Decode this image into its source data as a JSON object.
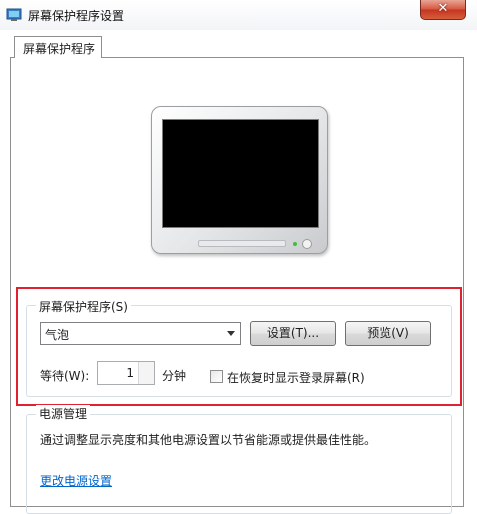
{
  "window": {
    "title": "屏幕保护程序设置",
    "close_glyph": "✕"
  },
  "tab": {
    "label": "屏幕保护程序"
  },
  "screensaver": {
    "group_label": "屏幕保护程序(S)",
    "selected": "气泡",
    "settings_button": "设置(T)...",
    "preview_button": "预览(V)",
    "wait_label": "等待(W):",
    "wait_value": "1",
    "wait_unit": "分钟",
    "resume_checkbox_label": "在恢复时显示登录屏幕(R)",
    "resume_checked": false
  },
  "power": {
    "title": "电源管理",
    "description": "通过调整显示亮度和其他电源设置以节省能源或提供最佳性能。",
    "link": "更改电源设置"
  },
  "colors": {
    "highlight_border": "#e0212f",
    "link": "#0066cc",
    "close_button": "#d7553f"
  }
}
